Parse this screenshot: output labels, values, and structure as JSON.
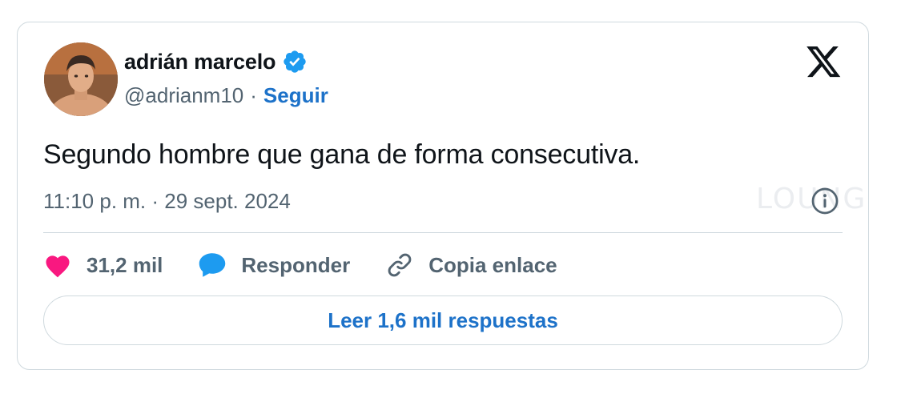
{
  "author": {
    "display_name": "adrián marcelo",
    "handle": "@adrianm10",
    "separator": "·",
    "follow_label": "Seguir",
    "verified": true,
    "avatar": "profile-photo"
  },
  "tweet": {
    "text": "Segundo hombre que gana de forma consecutiva.",
    "timestamp": "11:10 p. m. · 29 sept. 2024"
  },
  "actions": {
    "like": {
      "icon": "heart-icon",
      "label": "31,2 mil"
    },
    "reply": {
      "icon": "speech-bubble-icon",
      "label": "Responder"
    },
    "copy_link": {
      "icon": "link-icon",
      "label": "Copia enlace"
    }
  },
  "read_replies_label": "Leer 1,6 mil respuestas",
  "watermark": "LOUNG",
  "colors": {
    "accent": "#1d72c9",
    "verified": "#1d9bf0",
    "like": "#f91880",
    "reply": "#1d9bf0",
    "muted": "#536471",
    "border": "#cfd9de"
  }
}
